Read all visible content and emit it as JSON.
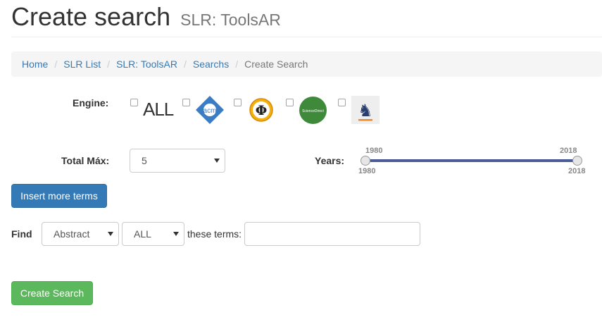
{
  "header": {
    "title": "Create search",
    "subtitle": "SLR: ToolsAR"
  },
  "breadcrumb": [
    "Home",
    "SLR List",
    "SLR: ToolsAR",
    "Searchs",
    "Create Search"
  ],
  "engine": {
    "label": "Engine:",
    "options": [
      {
        "name": "ALL",
        "checked": false
      },
      {
        "name": "acm",
        "checked": false
      },
      {
        "name": "phi",
        "checked": false
      },
      {
        "name": "ScienceDirect",
        "checked": false
      },
      {
        "name": "knight",
        "checked": false
      }
    ]
  },
  "total_max": {
    "label": "Total Máx:",
    "value": "5"
  },
  "years": {
    "label": "Years:",
    "min": "1980",
    "max": "2018",
    "from": "1980",
    "to": "2018"
  },
  "buttons": {
    "insert_terms": "Insert more terms",
    "create_search": "Create Search"
  },
  "find": {
    "label": "Find",
    "field_value": "Abstract",
    "operator_value": "ALL",
    "suffix": "these terms:",
    "terms_value": ""
  },
  "colors": {
    "primary": "#337ab7",
    "success": "#5cb85c",
    "slider": "#4a5a9a"
  }
}
